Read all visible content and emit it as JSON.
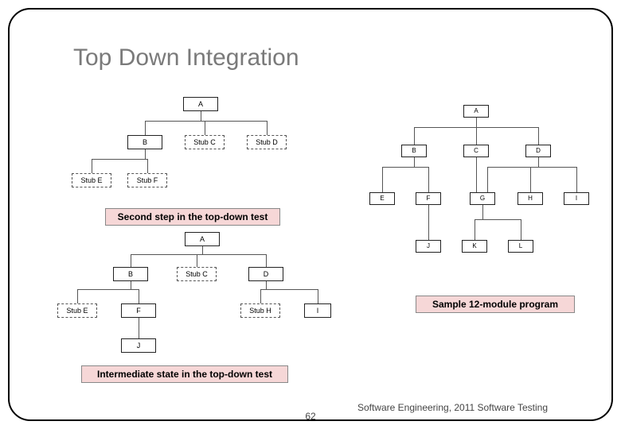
{
  "title": "Top Down Integration",
  "captions": {
    "second_step": "Second step in the top-down test",
    "intermediate": "Intermediate state in the top-down test",
    "sample": "Sample 12-module program"
  },
  "diagram_top_left": {
    "A": "A",
    "B": "B",
    "StubC": "Stub C",
    "StubD": "Stub D",
    "StubE": "Stub E",
    "StubF": "Stub F"
  },
  "diagram_bottom_left": {
    "A": "A",
    "B": "B",
    "StubC": "Stub C",
    "D": "D",
    "StubE": "Stub E",
    "F": "F",
    "StubH": "Stub H",
    "I": "I",
    "J": "J"
  },
  "diagram_right": {
    "A": "A",
    "B": "B",
    "C": "C",
    "D": "D",
    "E": "E",
    "F": "F",
    "G": "G",
    "H": "H",
    "I": "I",
    "J": "J",
    "K": "K",
    "L": "L"
  },
  "footer": "Software Engineering, 2011 Software Testing",
  "page_number": "62",
  "chart_data": [
    {
      "type": "diagram",
      "name": "Second step in the top-down test",
      "tree": {
        "A": [
          "B",
          "Stub C",
          "Stub D"
        ],
        "B": [
          "Stub E",
          "Stub F"
        ]
      }
    },
    {
      "type": "diagram",
      "name": "Intermediate state in the top-down test",
      "tree": {
        "A": [
          "B",
          "Stub C",
          "D"
        ],
        "B": [
          "Stub E",
          "F"
        ],
        "D": [
          "Stub H",
          "I"
        ],
        "F": [
          "J"
        ]
      }
    },
    {
      "type": "diagram",
      "name": "Sample 12-module program",
      "tree": {
        "A": [
          "B",
          "C",
          "D"
        ],
        "B": [
          "E",
          "F"
        ],
        "C": [
          "G"
        ],
        "D": [
          "G",
          "H",
          "I"
        ],
        "F": [
          "J"
        ],
        "G": [
          "K",
          "L"
        ]
      }
    }
  ]
}
